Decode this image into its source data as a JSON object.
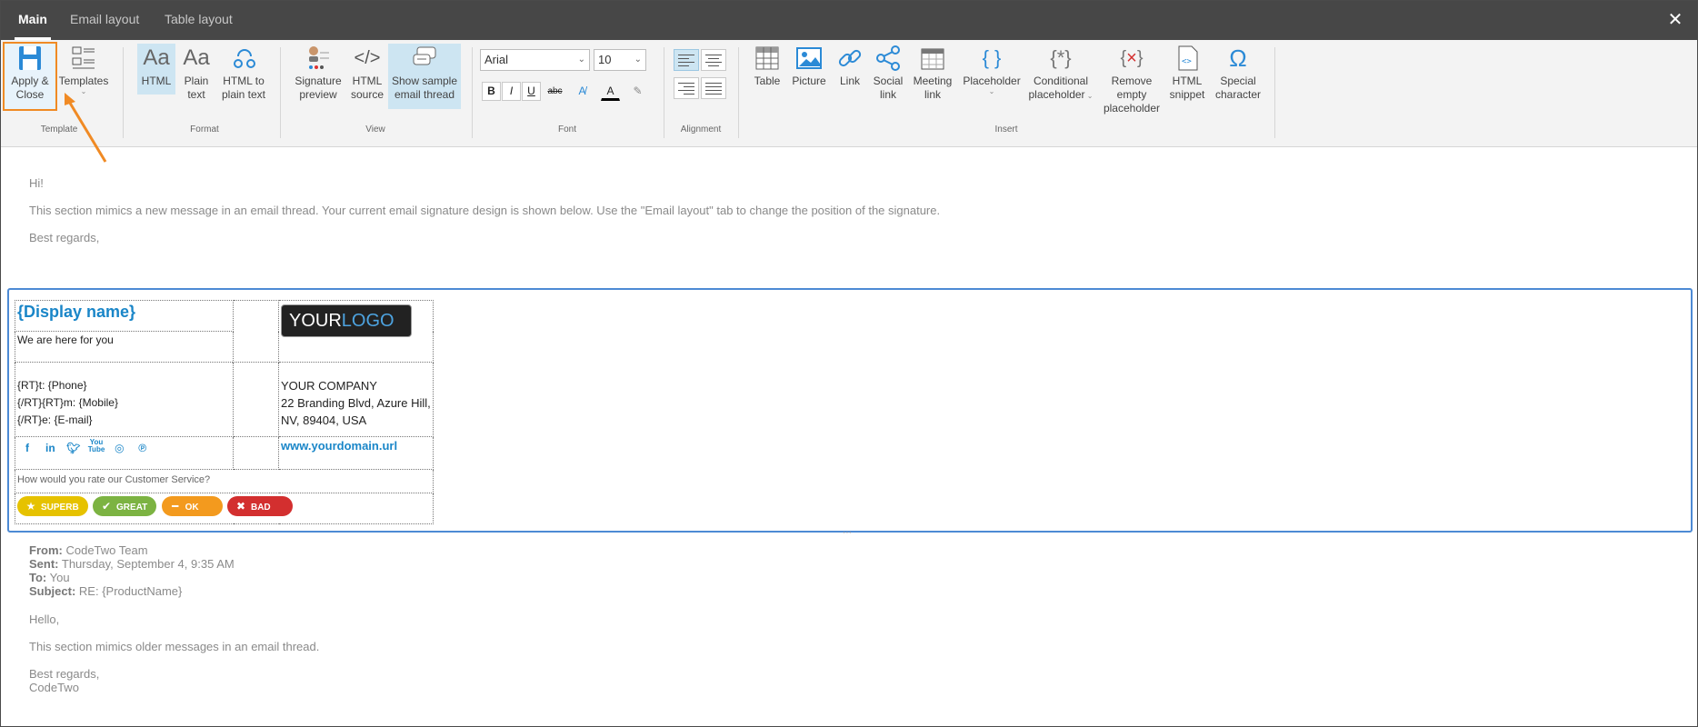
{
  "tabs": [
    {
      "label": "Main",
      "active": true
    },
    {
      "label": "Email layout",
      "active": false
    },
    {
      "label": "Table layout",
      "active": false
    }
  ],
  "close_icon": "close-icon",
  "ribbon": {
    "template": {
      "label": "Template",
      "apply_close_1": "Apply &",
      "apply_close_2": "Close",
      "templates": "Templates"
    },
    "format": {
      "label": "Format",
      "html": "HTML",
      "plain_1": "Plain",
      "plain_2": "text",
      "html_plain_1": "HTML to",
      "html_plain_2": "plain text"
    },
    "view": {
      "label": "View",
      "sig_preview_1": "Signature",
      "sig_preview_2": "preview",
      "html_source_1": "HTML",
      "html_source_2": "source",
      "show_thread_1": "Show sample",
      "show_thread_2": "email thread"
    },
    "font": {
      "label": "Font",
      "family": "Arial",
      "size": "10",
      "bold": "B",
      "italic": "I",
      "underline": "U",
      "strike": "abc"
    },
    "alignment": {
      "label": "Alignment"
    },
    "insert": {
      "label": "Insert",
      "table": "Table",
      "picture": "Picture",
      "link": "Link",
      "social_1": "Social",
      "social_2": "link",
      "meeting_1": "Meeting",
      "meeting_2": "link",
      "placeholder": "Placeholder",
      "cond_1": "Conditional",
      "cond_2": "placeholder",
      "remove_1": "Remove",
      "remove_2": "empty",
      "remove_3": "placeholder",
      "snippet_1": "HTML",
      "snippet_2": "snippet",
      "special_1": "Special",
      "special_2": "character"
    }
  },
  "body": {
    "greeting": "Hi!",
    "intro": "This section mimics a new message in an email thread. Your current email signature design is shown below. Use the \"Email layout\" tab to change the position of the signature.",
    "closing": "Best regards,"
  },
  "signature": {
    "display_name": "{Display name}",
    "tagline": "We are here for you",
    "logo_your": "YOUR",
    "logo_logo": "LOGO",
    "phone": "{RT}t: {Phone}",
    "mobile": "{/RT}{RT}m: {Mobile}",
    "email": "{/RT}e: {E-mail}",
    "company": "YOUR COMPANY",
    "address_1": "22 Branding Blvd, Azure Hill,",
    "address_2": "NV, 89404, USA",
    "url": "www.yourdomain.url",
    "social": {
      "facebook": "f",
      "linkedin": "in",
      "twitter": "t",
      "youtube": "You Tube",
      "instagram": "instagram",
      "pinterest": "pinterest"
    },
    "rating_question": "How would you rate our Customer Service?",
    "ratings": [
      {
        "label": "SUPERB",
        "color": "#e6c200",
        "icon": "star-icon"
      },
      {
        "label": "GREAT",
        "color": "#7cb342",
        "icon": "check-icon"
      },
      {
        "label": "OK",
        "color": "#f39a1e",
        "icon": "minus-icon"
      },
      {
        "label": "BAD",
        "color": "#d32f2f",
        "icon": "x-icon"
      }
    ]
  },
  "thread": {
    "from_label": "From:",
    "from": "CodeTwo Team",
    "sent_label": "Sent:",
    "sent": "Thursday, September 4, 9:35 AM",
    "to_label": "To:",
    "to": "You",
    "subject_label": "Subject:",
    "subject": "RE: {ProductName}",
    "hello": "Hello,",
    "older": "This section mimics older messages in an email thread.",
    "regards": "Best regards,",
    "signoff": "CodeTwo"
  },
  "colors": {
    "accent": "#1a86c8",
    "highlight": "#f08a24",
    "tabbar": "#474747",
    "selected": "#cde5f2"
  }
}
